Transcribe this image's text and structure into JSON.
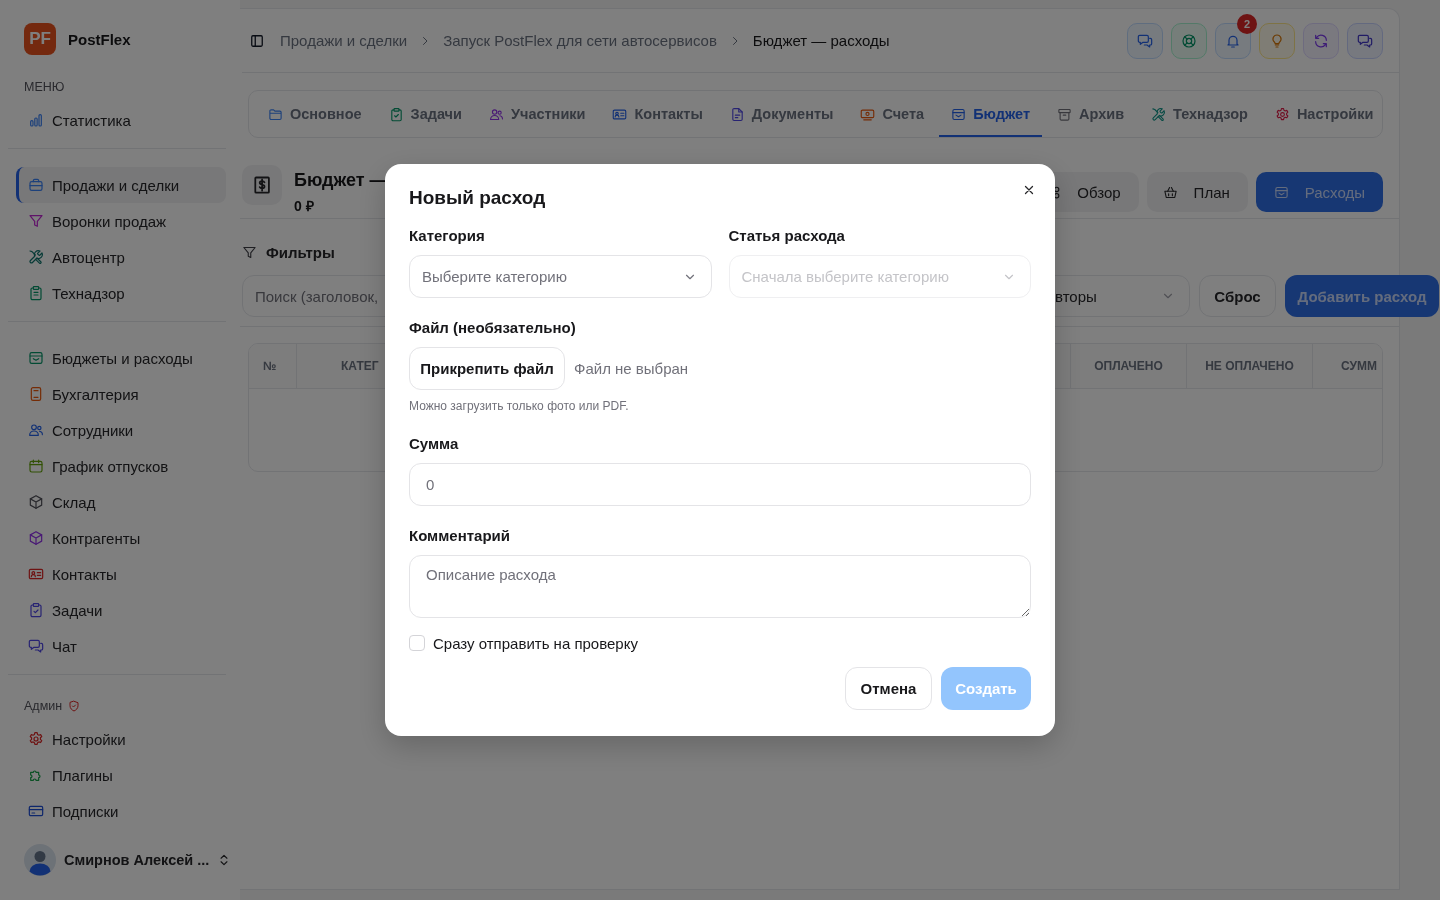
{
  "sidebar": {
    "logo": "PF",
    "brand": "PostFlex",
    "sections": [
      {
        "title": "МЕНЮ",
        "items": [
          {
            "label": "Статистика",
            "selected": false
          }
        ]
      },
      {
        "items": [
          {
            "label": "Продажи и сделки",
            "selected": true
          },
          {
            "label": "Воронки продаж",
            "selected": false
          },
          {
            "label": "Автоцентр",
            "selected": false
          },
          {
            "label": "Технадзор",
            "selected": false
          }
        ]
      },
      {
        "items": [
          {
            "label": "Бюджеты и расходы",
            "selected": false
          },
          {
            "label": "Бухгалтерия",
            "selected": false
          },
          {
            "label": "Сотрудники",
            "selected": false
          },
          {
            "label": "График отпусков",
            "selected": false
          },
          {
            "label": "Склад",
            "selected": false
          },
          {
            "label": "Контрагенты",
            "selected": false
          },
          {
            "label": "Контакты",
            "selected": false
          },
          {
            "label": "Задачи",
            "selected": false
          },
          {
            "label": "Чат",
            "selected": false
          }
        ]
      },
      {
        "title": "Админ",
        "items": [
          {
            "label": "Настройки",
            "selected": false
          },
          {
            "label": "Плагины",
            "selected": false
          },
          {
            "label": "Подписки",
            "selected": false
          }
        ]
      }
    ],
    "user": {
      "name": "Смирнов Алексей ..."
    }
  },
  "topbar": {
    "breadcrumbs": [
      "Продажи и сделки",
      "Запуск PostFlex для сети автосервисов",
      "Бюджет — расходы"
    ],
    "notifications_badge": "2"
  },
  "tabs": [
    {
      "label": "Основное",
      "selected": false
    },
    {
      "label": "Задачи",
      "selected": false
    },
    {
      "label": "Участники",
      "selected": false
    },
    {
      "label": "Контакты",
      "selected": false
    },
    {
      "label": "Документы",
      "selected": false
    },
    {
      "label": "Счета",
      "selected": false
    },
    {
      "label": "Бюджет",
      "selected": true
    },
    {
      "label": "Архив",
      "selected": false
    },
    {
      "label": "Технадзор",
      "selected": false
    },
    {
      "label": "Настройки",
      "selected": false
    }
  ],
  "budget_header": {
    "title": "Бюджет —",
    "total": "0 ₽",
    "views": [
      {
        "label": "Обзор",
        "selected": false
      },
      {
        "label": "План",
        "selected": false
      },
      {
        "label": "Расходы",
        "selected": true
      }
    ]
  },
  "filters": {
    "title": "Фильтры",
    "search": {
      "placeholder": "Поиск (заголовок,"
    },
    "select": {
      "value": "вторы"
    },
    "reset_button": "Сброс",
    "add_button": "Добавить расход"
  },
  "table": {
    "columns": [
      "№",
      "КАТЕГ",
      "ОПЛАЧЕНО",
      "НЕ ОПЛАЧЕНО",
      "СУММ"
    ]
  },
  "modal": {
    "title": "Новый расход",
    "category": {
      "label": "Категория",
      "placeholder": "Выберите категорию",
      "disabled": false
    },
    "item": {
      "label": "Статья расхода",
      "placeholder": "Сначала выберите категорию",
      "disabled": true
    },
    "file": {
      "label": "Файл (необязательно)",
      "button": "Прикрепить файл",
      "status": "Файл не выбран",
      "hint": "Можно загрузить только фото или PDF."
    },
    "amount": {
      "label": "Сумма",
      "placeholder": "0"
    },
    "comment": {
      "label": "Комментарий",
      "placeholder": "Описание расхода"
    },
    "checkbox": {
      "label": "Сразу отправить на проверку",
      "checked": false
    },
    "cancel_button": "Отмена",
    "submit": {
      "label": "Создать",
      "disabled": true
    }
  }
}
